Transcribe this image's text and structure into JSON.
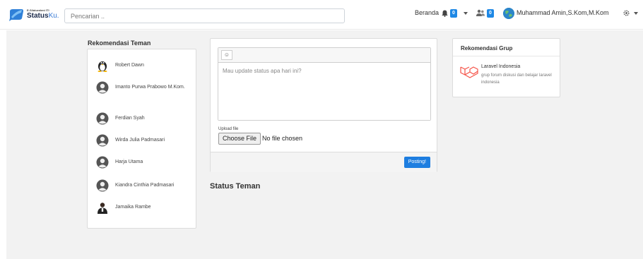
{
  "brand": {
    "subtitle": "E-Silaturahmi ITI",
    "name_bold": "Status",
    "name_light": "Ku."
  },
  "search": {
    "placeholder": "Pencarian .."
  },
  "nav": {
    "home": "Beranda",
    "notif_count": "0",
    "friend_req_count": "0",
    "user_name": "Muhammad Amin,S.Kom,M.Kom"
  },
  "friends": {
    "title": "Rekomendasi Teman",
    "items": [
      {
        "name": "Robert Dawn",
        "icon": "linux-penguin-icon"
      },
      {
        "name": "Imanto Purwa Prabowo M.Kom.",
        "icon": "default-avatar-icon"
      },
      {
        "name": "Ferdian Syah",
        "icon": "default-avatar-icon"
      },
      {
        "name": "Wirda Julia Padmasari",
        "icon": "default-avatar-icon"
      },
      {
        "name": "Harja Utama",
        "icon": "default-avatar-icon"
      },
      {
        "name": "Kiandra Cinthia Padmasari",
        "icon": "default-avatar-icon"
      },
      {
        "name": "Jamaika Rambe",
        "icon": "photo-avatar-icon"
      }
    ]
  },
  "post": {
    "emoji": "☺",
    "placeholder": "Mau update status apa hari ini?",
    "upload_label": "Upload file",
    "file_button": "Choose File",
    "file_status": "No file chosen",
    "submit": "Posting!"
  },
  "status": {
    "title": "Status Teman"
  },
  "groups": {
    "title": "Rekomendasi Grup",
    "items": [
      {
        "name": "Laravel Indonesia",
        "desc": "grup forum diskusi dan belajar laravel indonesia"
      }
    ]
  },
  "colors": {
    "accent": "#1e7ee0",
    "background": "#f2f2f2",
    "laravel": "#f55247"
  }
}
